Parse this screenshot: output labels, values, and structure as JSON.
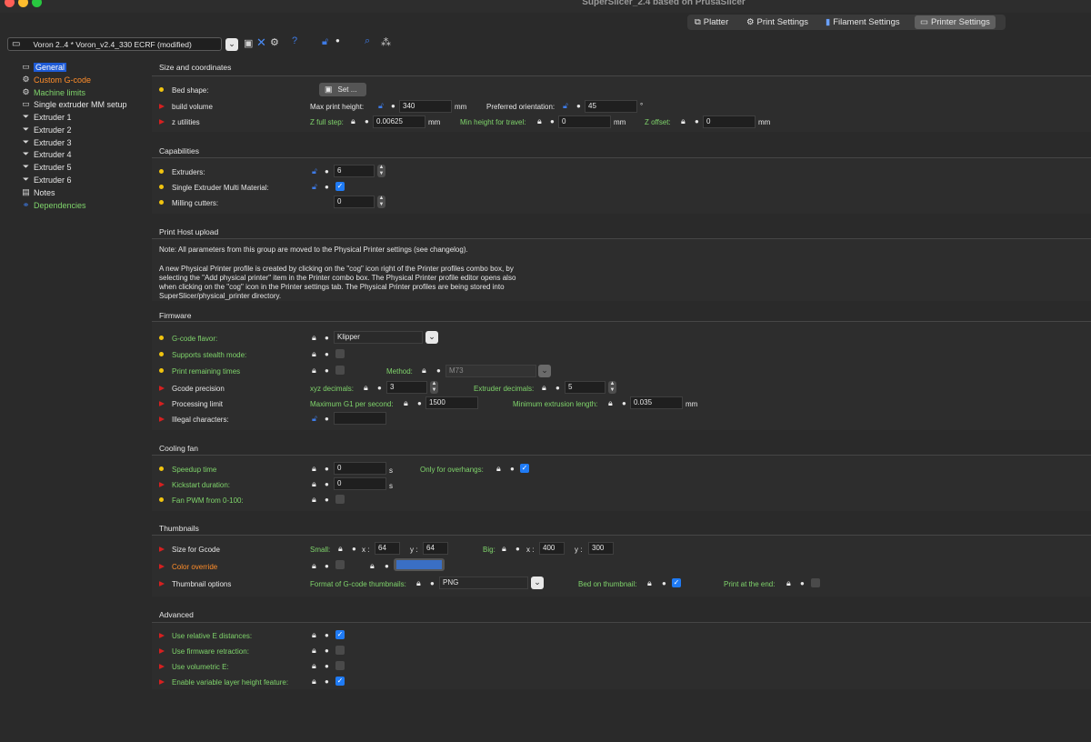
{
  "window": {
    "title": "SuperSlicer_2.4  based on PrusaSlicer"
  },
  "tabs": [
    {
      "label": "Platter"
    },
    {
      "label": "Print Settings"
    },
    {
      "label": "Filament Settings"
    },
    {
      "label": "Printer Settings"
    }
  ],
  "preset": {
    "value": "Voron 2..4 * Voron_v2.4_330 ECRF (modified)"
  },
  "sidebar": [
    {
      "label": "General"
    },
    {
      "label": "Custom G-code"
    },
    {
      "label": "Machine limits"
    },
    {
      "label": "Single extruder MM setup"
    },
    {
      "label": "Extruder 1"
    },
    {
      "label": "Extruder 2"
    },
    {
      "label": "Extruder 3"
    },
    {
      "label": "Extruder 4"
    },
    {
      "label": "Extruder 5"
    },
    {
      "label": "Extruder 6"
    },
    {
      "label": "Notes"
    },
    {
      "label": "Dependencies"
    }
  ],
  "size": {
    "title": "Size and coordinates",
    "bed_shape": "Bed shape:",
    "set_btn": "Set ...",
    "build_volume": "build volume",
    "max_print_height": "Max print height:",
    "max_print_height_val": "340",
    "mm": "mm",
    "preferred_orientation": "Preferred orientation:",
    "preferred_orientation_val": "45",
    "deg": "°",
    "z_utilities": "z utilities",
    "z_full_step": "Z full step:",
    "z_full_step_val": "0.00625",
    "min_height_travel": "Min height for travel:",
    "min_height_travel_val": "0",
    "z_offset": "Z offset:",
    "z_offset_val": "0"
  },
  "capabilities": {
    "title": "Capabilities",
    "extruders": "Extruders:",
    "extruders_val": "6",
    "single_mm": "Single Extruder Multi Material:",
    "milling": "Milling cutters:",
    "milling_val": "0"
  },
  "host": {
    "title": "Print Host upload",
    "note1": "Note: All parameters from this group are moved to the Physical Printer settings (see changelog).",
    "note2": "A new Physical Printer profile is created by clicking on the \"cog\" icon right of the Printer profiles combo box, by",
    "note3": "selecting the \"Add physical printer\" item in the Printer combo box. The Physical Printer profile editor opens also",
    "note4": "when clicking on the \"cog\" icon in the Printer settings tab. The Physical Printer profiles are being stored into",
    "note5": "SuperSlicer/physical_printer directory."
  },
  "firmware": {
    "title": "Firmware",
    "gcode_flavor": "G-code flavor:",
    "gcode_flavor_val": "Klipper",
    "stealth": "Supports stealth mode:",
    "remaining": "Print remaining times",
    "method": "Method:",
    "method_val": "M73",
    "gcode_precision": "Gcode precision",
    "xyz_decimals": "xyz decimals:",
    "xyz_decimals_val": "3",
    "extruder_decimals": "Extruder decimals:",
    "extruder_decimals_val": "5",
    "processing_limit": "Processing limit",
    "max_g1": "Maximum G1 per second:",
    "max_g1_val": "1500",
    "min_extrusion": "Minimum extrusion length:",
    "min_extrusion_val": "0.035",
    "illegal": "Illegal characters:"
  },
  "cooling": {
    "title": "Cooling fan",
    "speedup": "Speedup time",
    "speedup_val": "0",
    "s": "s",
    "kickstart": "Kickstart duration:",
    "kickstart_val": "0",
    "pwm": "Fan PWM from 0-100:",
    "overhangs": "Only for overhangs:"
  },
  "thumbnails": {
    "title": "Thumbnails",
    "size_gcode": "Size for Gcode",
    "small": "Small:",
    "x": "x :",
    "y": "y :",
    "small_x": "64",
    "small_y": "64",
    "big": "Big:",
    "big_x": "400",
    "big_y": "300",
    "color_override": "Color override",
    "options": "Thumbnail options",
    "format": "Format of G-code thumbnails:",
    "format_val": "PNG",
    "bed_thumb": "Bed on thumbnail:",
    "print_end": "Print at the end:"
  },
  "advanced": {
    "title": "Advanced",
    "relative_e": "Use relative E distances:",
    "fw_retraction": "Use firmware retraction:",
    "volumetric": "Use volumetric E:",
    "variable_layer": "Enable variable layer height feature:"
  },
  "colors": {
    "accent": "#1e5bd6",
    "green": "#7fd46b",
    "orange": "#ff8d2a",
    "checkbox": "#1f7bf5",
    "swatch": "#3a6fc4"
  }
}
